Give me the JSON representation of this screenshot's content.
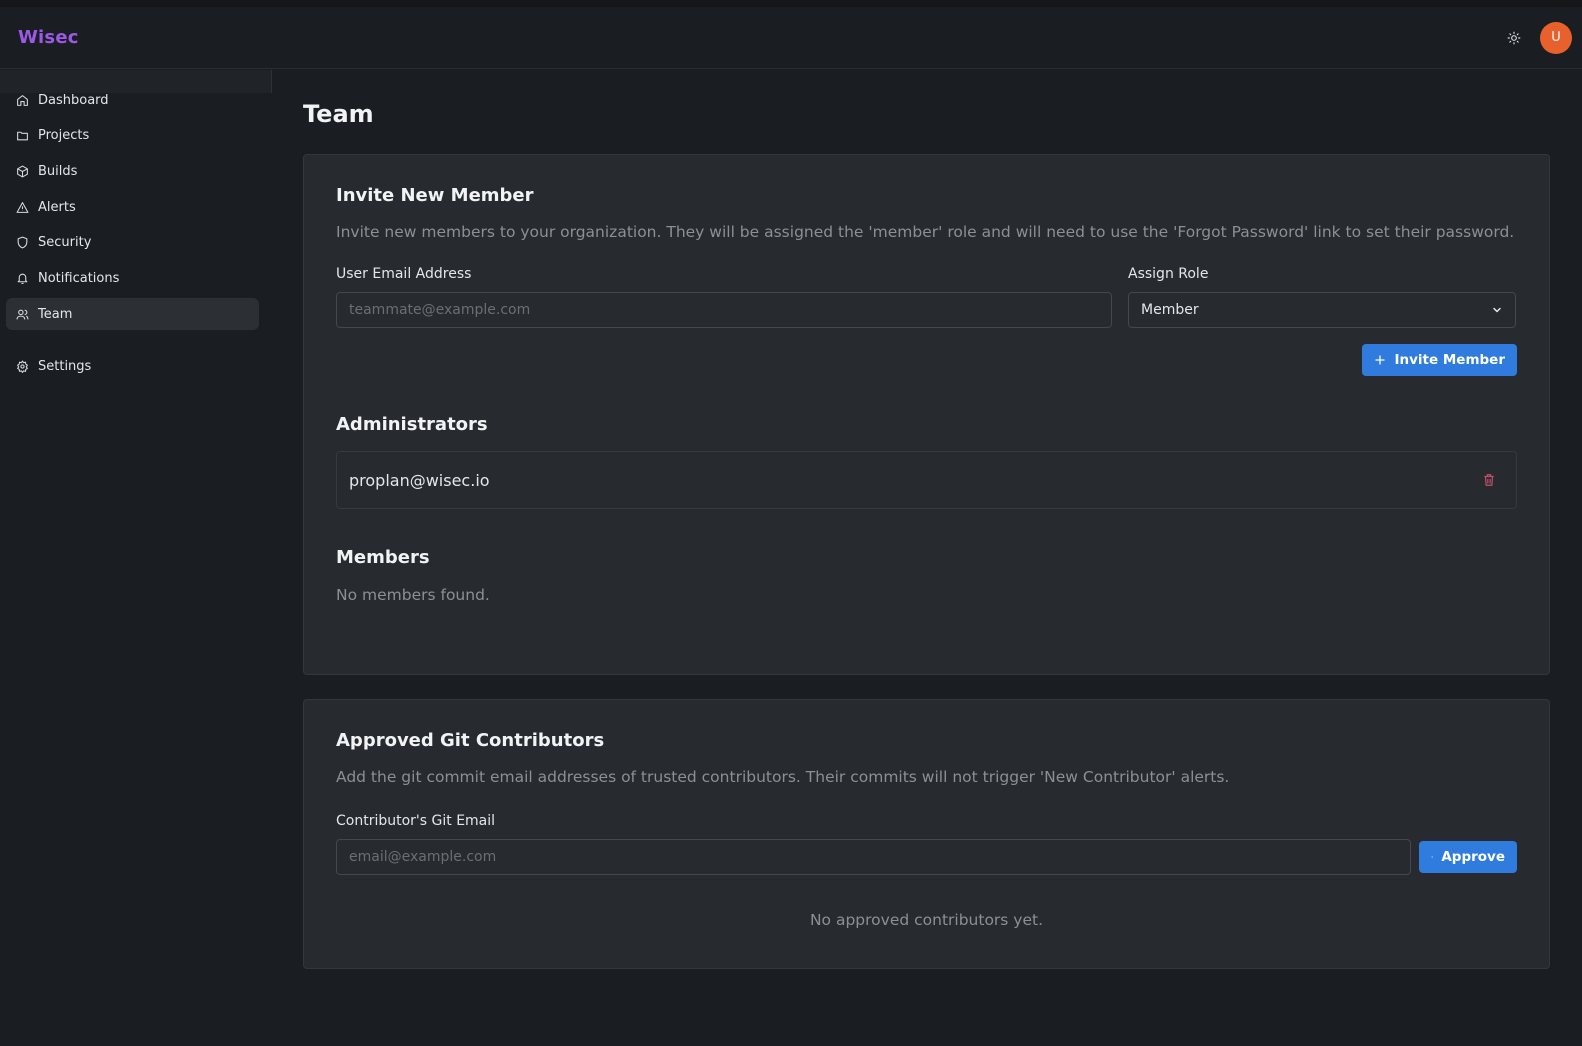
{
  "app": {
    "logo": "Wisec"
  },
  "header": {
    "avatar_initial": "U",
    "theme_icon": "sun-icon"
  },
  "colors": {
    "accent": "#9b59e6",
    "primary_button": "#2f7cde",
    "avatar": "#e8612c",
    "danger": "#c0516a"
  },
  "sidebar": {
    "items": [
      {
        "label": "Dashboard",
        "icon": "home-icon"
      },
      {
        "label": "Projects",
        "icon": "folder-icon"
      },
      {
        "label": "Builds",
        "icon": "box-icon"
      },
      {
        "label": "Alerts",
        "icon": "alert-triangle-icon"
      },
      {
        "label": "Security",
        "icon": "shield-icon"
      },
      {
        "label": "Notifications",
        "icon": "bell-icon"
      },
      {
        "label": "Team",
        "icon": "users-icon",
        "active": true
      },
      {
        "label": "Settings",
        "icon": "gear-icon"
      }
    ]
  },
  "page": {
    "title": "Team"
  },
  "invite": {
    "title": "Invite New Member",
    "description": "Invite new members to your organization. They will be assigned the 'member' role and will need to use the 'Forgot Password' link to set their password.",
    "email_label": "User Email Address",
    "email_placeholder": "teammate@example.com",
    "email_value": "",
    "role_label": "Assign Role",
    "role_value": "Member",
    "button_label": "Invite Member"
  },
  "administrators": {
    "title": "Administrators",
    "list": [
      {
        "email": "proplan@wisec.io"
      }
    ]
  },
  "members": {
    "title": "Members",
    "empty_text": "No members found."
  },
  "contributors": {
    "title": "Approved Git Contributors",
    "description": "Add the git commit email addresses of trusted contributors. Their commits will not trigger 'New Contributor' alerts.",
    "email_label": "Contributor's Git Email",
    "email_placeholder": "email@example.com",
    "email_value": "",
    "button_label": "Approve",
    "empty_text": "No approved contributors yet."
  }
}
